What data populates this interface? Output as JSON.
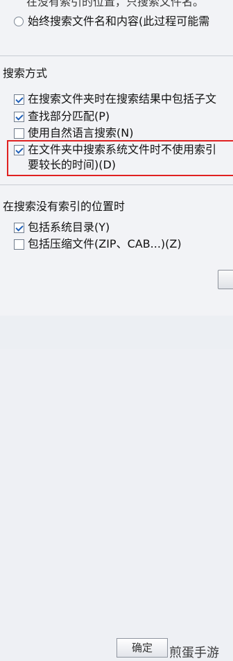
{
  "options": {
    "top_partial_line": "在没有索引的位置，只搜索文件名。",
    "radio_always": "始终搜索文件名和内容(此过程可能需"
  },
  "search_method": {
    "heading": "搜索方式",
    "items": [
      {
        "label": "在搜索文件夹时在搜索结果中包括子文",
        "checked": true
      },
      {
        "label": "查找部分匹配(P)",
        "checked": true
      },
      {
        "label": "使用自然语言搜索(N)",
        "checked": false
      },
      {
        "label": "在文件夹中搜索系统文件时不使用索引",
        "label_line2": "要较长的时间)(D)",
        "checked": true
      }
    ]
  },
  "non_indexed": {
    "heading": "在搜索没有索引的位置时",
    "items": [
      {
        "label": "包括系统目录(Y)",
        "checked": true
      },
      {
        "label": "包括压缩文件(ZIP、CAB...)(Z)",
        "checked": false
      }
    ]
  },
  "footer": {
    "ok_label": "确定",
    "watermark": "煎蛋手游"
  }
}
